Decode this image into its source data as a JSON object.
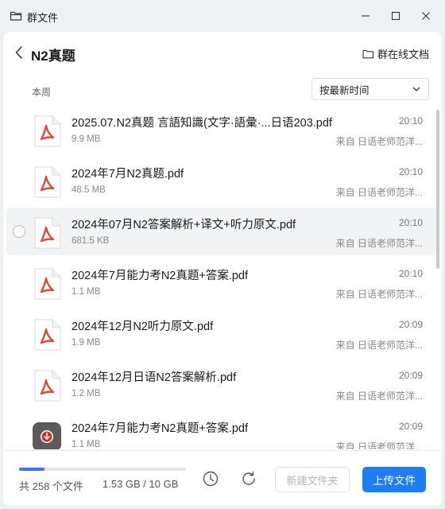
{
  "window": {
    "title": "群文件"
  },
  "header": {
    "title": "N2真题",
    "online_docs_label": "群在线文档"
  },
  "section": {
    "label": "本周"
  },
  "sort": {
    "selected": "按最新时间"
  },
  "files": [
    {
      "name": "2025.07.N2真题 言語知識(文字·語彙·...日语203.pdf",
      "size": "9.9 MB",
      "time": "20:10",
      "from": "来自 日语老师范洋...",
      "icon": "pdf-icon"
    },
    {
      "name": "2024年7月N2真题.pdf",
      "size": "48.5 MB",
      "time": "20:10",
      "from": "来自 日语老师范洋...",
      "icon": "pdf-icon"
    },
    {
      "name": "2024年07月N2答案解析+译文+听力原文.pdf",
      "size": "681.5 KB",
      "time": "20:10",
      "from": "来自 日语老师范洋...",
      "icon": "pdf-icon"
    },
    {
      "name": "2024年7月能力考N2真题+答案.pdf",
      "size": "1.1 MB",
      "time": "20:10",
      "from": "来自 日语老师范洋...",
      "icon": "pdf-icon"
    },
    {
      "name": "2024年12月N2听力原文.pdf",
      "size": "1.9 MB",
      "time": "20:09",
      "from": "来自 日语老师范洋...",
      "icon": "pdf-icon"
    },
    {
      "name": "2024年12月日语N2答案解析.pdf",
      "size": "1.2 MB",
      "time": "20:09",
      "from": "来自 日语老师范洋...",
      "icon": "pdf-icon"
    },
    {
      "name": "2024年7月能力考N2真题+答案.pdf",
      "size": "1.1 MB",
      "time": "20:09",
      "from": "来自 日语老师范洋...",
      "icon": "download-icon"
    }
  ],
  "footer": {
    "count": "共 258 个文件",
    "storage": "1.53 GB / 10 GB",
    "storage_used_fraction": 0.153,
    "new_folder_label": "新建文件夹",
    "upload_label": "上传文件"
  },
  "colors": {
    "accent": "#1f7df2",
    "pdf_red": "#e04a3c"
  }
}
